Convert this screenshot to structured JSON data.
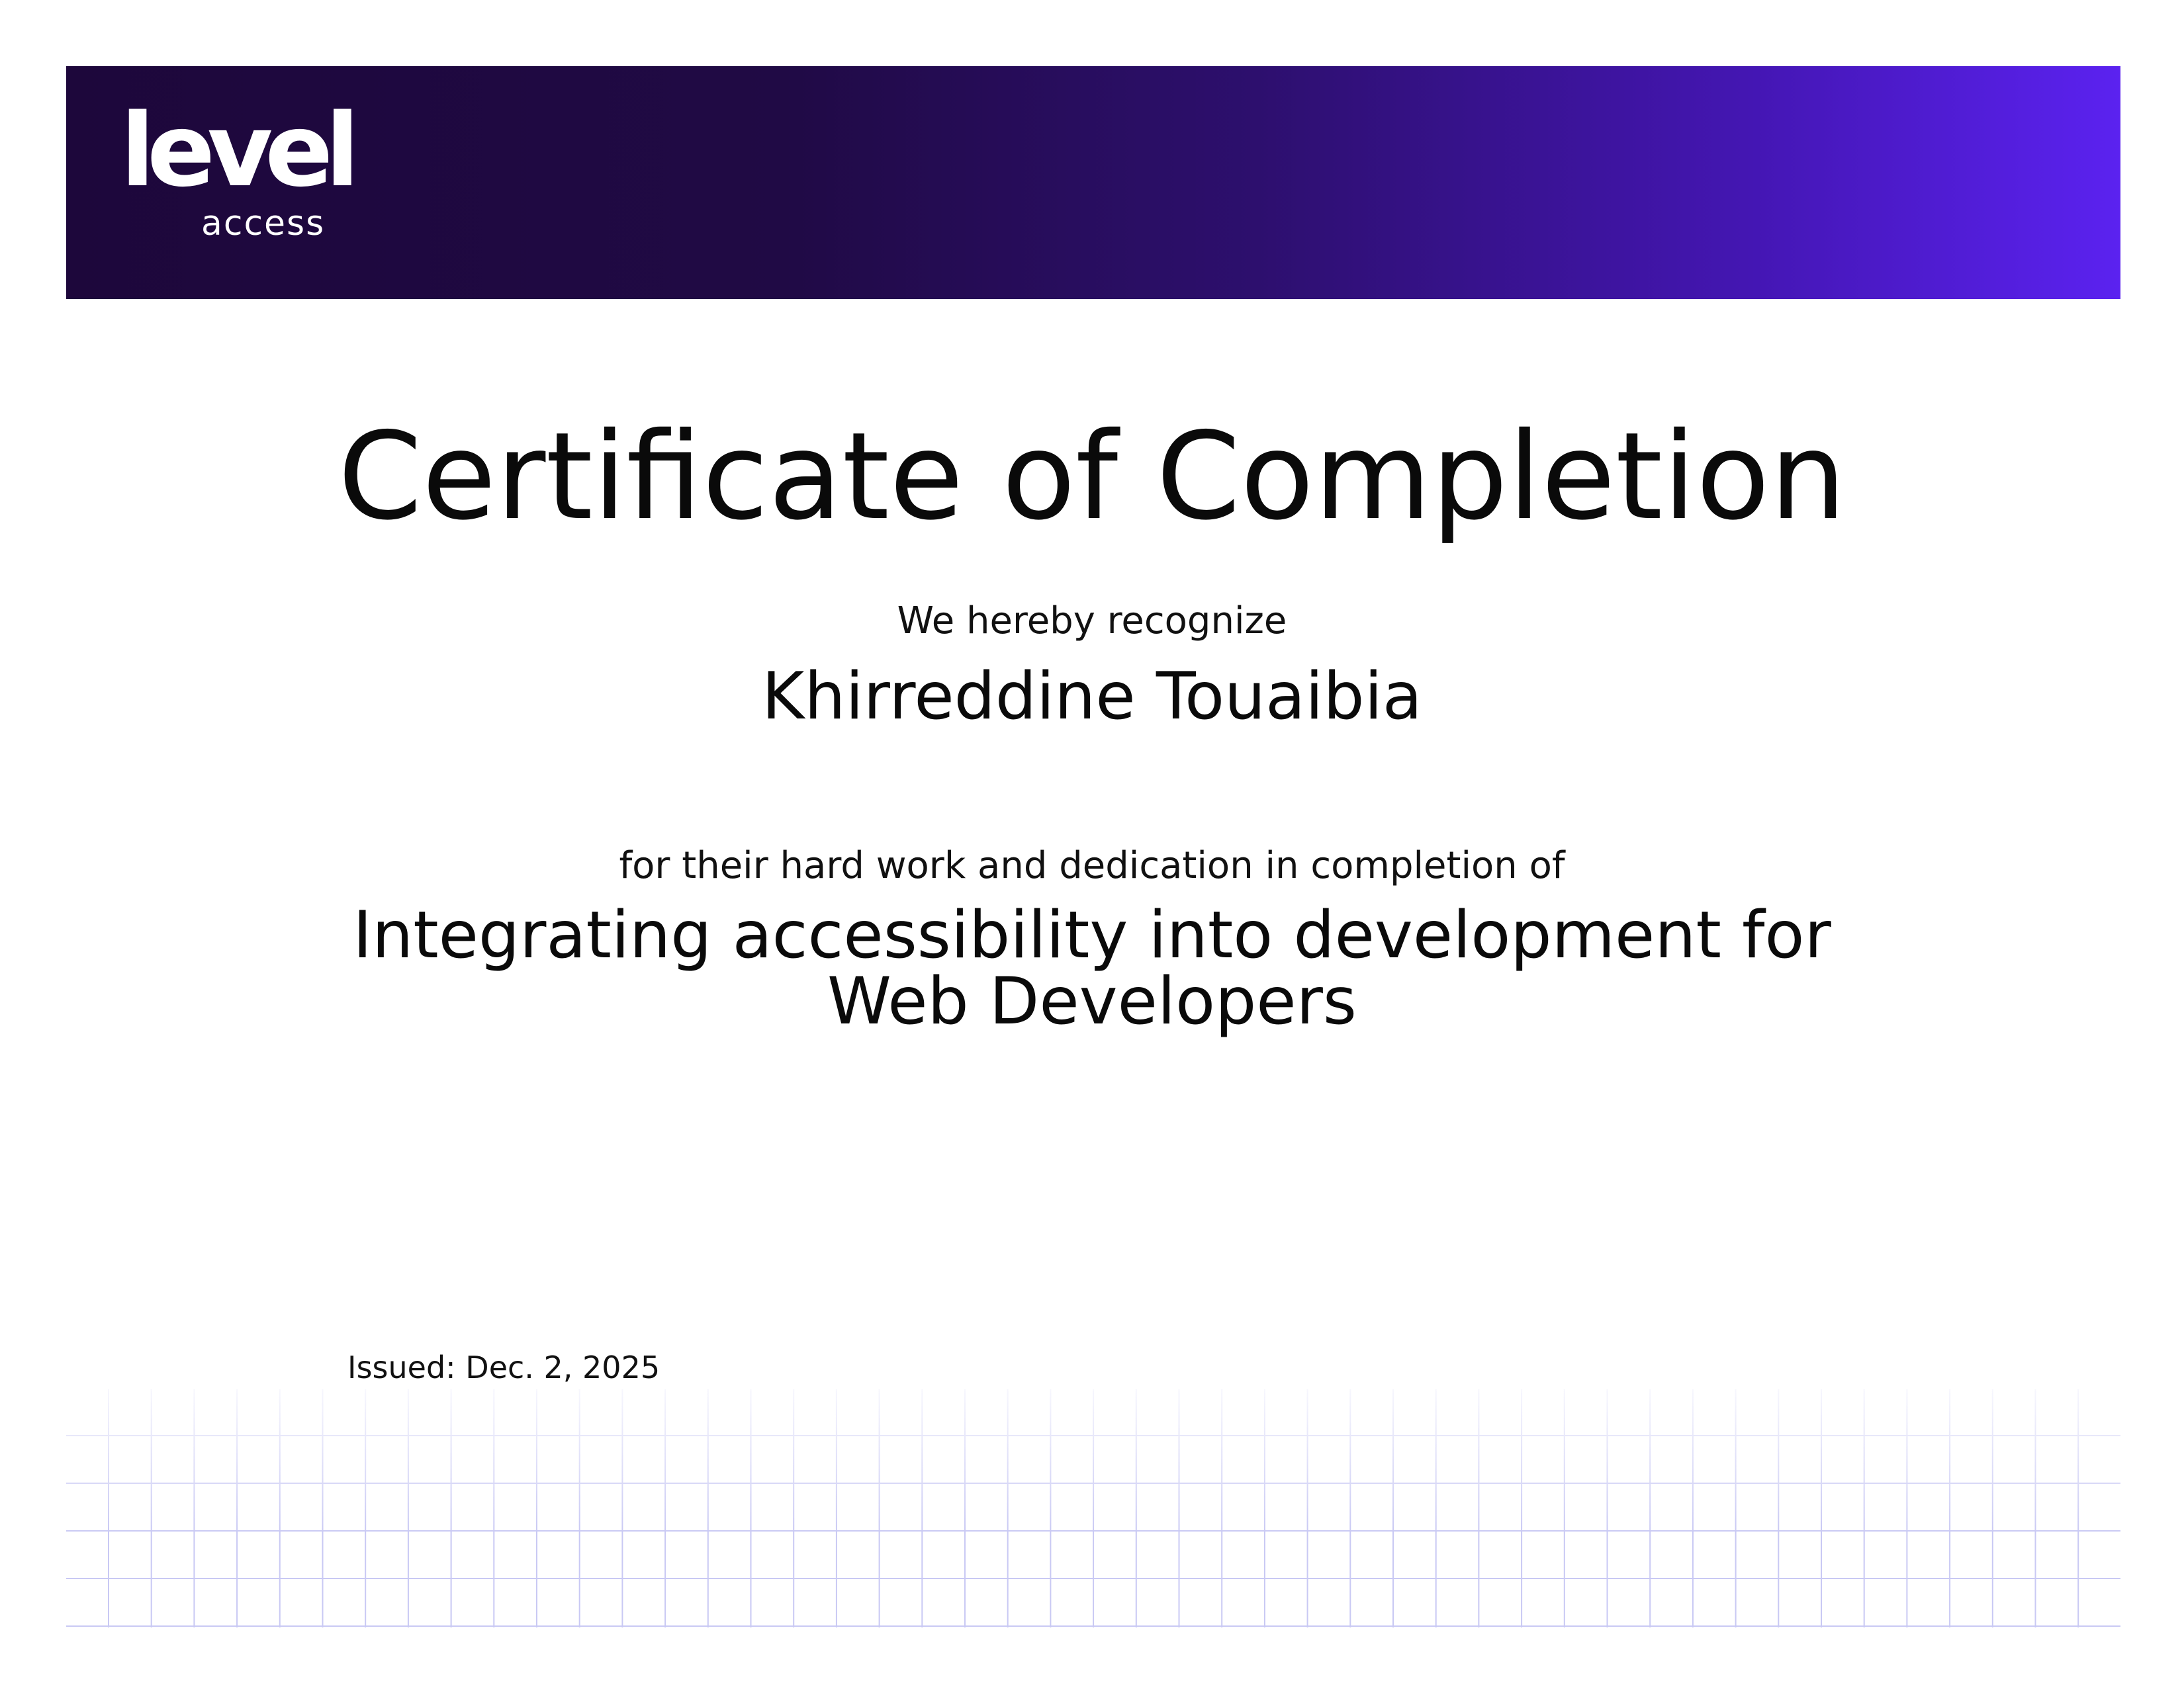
{
  "header": {
    "logo_word": "level",
    "logo_sub": "access",
    "gradient_colors": [
      "#1d073b",
      "#200a45",
      "#2d0f6e",
      "#4416b3",
      "#5b22f0"
    ]
  },
  "certificate": {
    "title": "Certificate of Completion",
    "recognize_text": "We hereby recognize",
    "recipient_name": "Khirreddine Touaibia",
    "dedication_text": "for their hard work and dedication in completion of",
    "course_line_1": "Integrating accessibility into development for",
    "course_line_2": "Web Developers",
    "issued": "Issued: Dec. 2, 2025"
  },
  "decoration": {
    "grid_color": "#c9c9f4"
  }
}
